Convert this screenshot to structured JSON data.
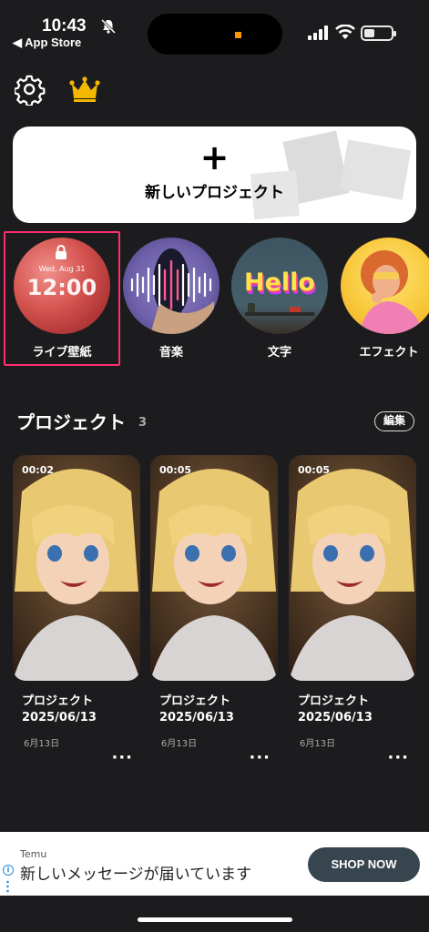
{
  "status_bar": {
    "time": "10:43",
    "back_app": "◀ App Store"
  },
  "new_project": {
    "plus": "+",
    "label": "新しいプロジェクト"
  },
  "categories": [
    {
      "label": "ライブ壁紙",
      "overlay_date": "Wed, Aug 31",
      "overlay_time": "12:00"
    },
    {
      "label": "音楽"
    },
    {
      "label": "文字",
      "overlay_text": "Hello"
    },
    {
      "label": "エフェクト"
    }
  ],
  "projects": {
    "title": "プロジェクト",
    "count": "3",
    "edit_label": "編集",
    "items": [
      {
        "duration": "00:02",
        "name_line1": "プロジェクト",
        "name_line2": "2025/06/13",
        "date": "6月13日"
      },
      {
        "duration": "00:05",
        "name_line1": "プロジェクト",
        "name_line2": "2025/06/13",
        "date": "6月13日"
      },
      {
        "duration": "00:05",
        "name_line1": "プロジェクト",
        "name_line2": "2025/06/13",
        "date": "6月13日"
      }
    ],
    "more_label": "···"
  },
  "ad": {
    "brand": "Temu",
    "text": "新しいメッセージが届いています",
    "cta": "SHOP NOW",
    "info": "i"
  },
  "colors": {
    "background": "#1c1c1e",
    "selected_border": "#ff2d6f",
    "crown": "#f5b800",
    "cta": "#37454f"
  }
}
